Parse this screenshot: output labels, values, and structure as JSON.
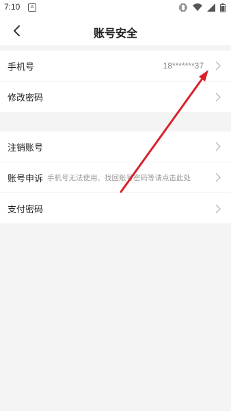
{
  "status_bar": {
    "time": "7:10",
    "notification_letter": "A",
    "icons": [
      "vibrate-icon",
      "wifi-icon",
      "cellular-signal-icon",
      "battery-icon"
    ]
  },
  "header": {
    "title": "账号安全",
    "back_icon": "chevron-left-icon"
  },
  "groups": [
    {
      "items": [
        {
          "label": "手机号",
          "value": "18*******37"
        },
        {
          "label": "修改密码"
        }
      ]
    },
    {
      "items": [
        {
          "label": "注销账号"
        },
        {
          "label": "账号申诉",
          "hint": "手机号无法使用、找回账号密码等请点击此处"
        },
        {
          "label": "支付密码"
        }
      ]
    }
  ],
  "annotation": {
    "type": "arrow",
    "color": "#d9202a",
    "points_to": "phone-number-value"
  }
}
